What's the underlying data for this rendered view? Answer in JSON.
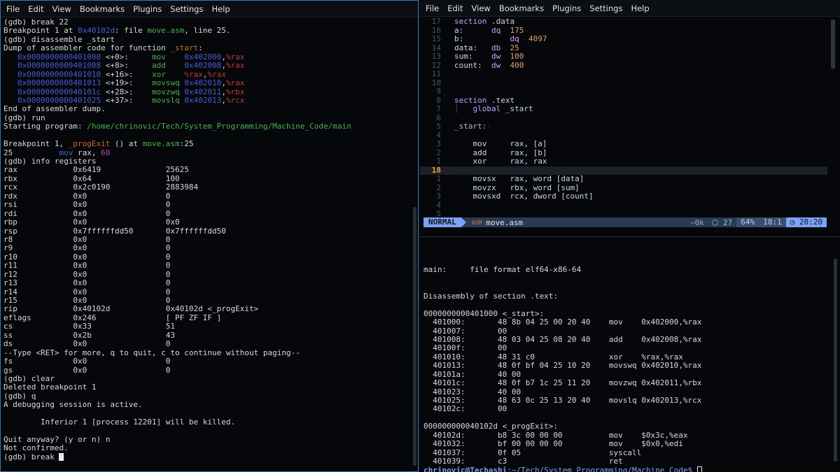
{
  "menu": [
    "File",
    "Edit",
    "View",
    "Bookmarks",
    "Plugins",
    "Settings",
    "Help"
  ],
  "left_terminal": {
    "lines": [
      [
        {
          "t": "(gdb) break 22"
        }
      ],
      [
        {
          "t": "Breakpoint 1 at "
        },
        {
          "t": "0x40102d",
          "c": "blue"
        },
        {
          "t": ": file "
        },
        {
          "t": "move.asm",
          "c": "green"
        },
        {
          "t": ", line 25."
        }
      ],
      [
        {
          "t": "(gdb) disassemble _start"
        }
      ],
      [
        {
          "t": "Dump of assembler code for function "
        },
        {
          "t": "_start",
          "c": "orange"
        },
        {
          "t": ":"
        }
      ],
      [
        {
          "t": "   "
        },
        {
          "t": "0x0000000000401000",
          "c": "blue"
        },
        {
          "t": " <+0>:     "
        },
        {
          "t": "mov",
          "c": "green"
        },
        {
          "t": "    "
        },
        {
          "t": "0x402000",
          "c": "blue"
        },
        {
          "t": ","
        },
        {
          "t": "%rax",
          "c": "red"
        }
      ],
      [
        {
          "t": "   "
        },
        {
          "t": "0x0000000000401008",
          "c": "blue"
        },
        {
          "t": " <+8>:     "
        },
        {
          "t": "add",
          "c": "green"
        },
        {
          "t": "    "
        },
        {
          "t": "0x402008",
          "c": "blue"
        },
        {
          "t": ","
        },
        {
          "t": "%rax",
          "c": "red"
        }
      ],
      [
        {
          "t": "   "
        },
        {
          "t": "0x0000000000401010",
          "c": "blue"
        },
        {
          "t": " <+16>:    "
        },
        {
          "t": "xor",
          "c": "green"
        },
        {
          "t": "    "
        },
        {
          "t": "%rax",
          "c": "red"
        },
        {
          "t": ","
        },
        {
          "t": "%rax",
          "c": "red"
        }
      ],
      [
        {
          "t": "   "
        },
        {
          "t": "0x0000000000401013",
          "c": "blue"
        },
        {
          "t": " <+19>:    "
        },
        {
          "t": "movswq",
          "c": "green"
        },
        {
          "t": " "
        },
        {
          "t": "0x402010",
          "c": "blue"
        },
        {
          "t": ","
        },
        {
          "t": "%rax",
          "c": "red"
        }
      ],
      [
        {
          "t": "   "
        },
        {
          "t": "0x000000000040101c",
          "c": "blue"
        },
        {
          "t": " <+28>:    "
        },
        {
          "t": "movzwq",
          "c": "green"
        },
        {
          "t": " "
        },
        {
          "t": "0x402011",
          "c": "blue"
        },
        {
          "t": ","
        },
        {
          "t": "%rbx",
          "c": "red"
        }
      ],
      [
        {
          "t": "   "
        },
        {
          "t": "0x0000000000401025",
          "c": "blue"
        },
        {
          "t": " <+37>:    "
        },
        {
          "t": "movslq",
          "c": "green"
        },
        {
          "t": " "
        },
        {
          "t": "0x402013",
          "c": "blue"
        },
        {
          "t": ","
        },
        {
          "t": "%rcx",
          "c": "red"
        }
      ],
      [
        {
          "t": "End of assembler dump."
        }
      ],
      [
        {
          "t": "(gdb) run"
        }
      ],
      [
        {
          "t": "Starting program: "
        },
        {
          "t": "/home/chrinovic/Tech/System_Programming/Machine_Code/main",
          "c": "green"
        }
      ],
      [
        {
          "t": ""
        }
      ],
      [
        {
          "t": "Breakpoint 1, "
        },
        {
          "t": "_progExit",
          "c": "orange"
        },
        {
          "t": " () at "
        },
        {
          "t": "move.asm",
          "c": "green"
        },
        {
          "t": ":25"
        }
      ],
      [
        {
          "t": "25          "
        },
        {
          "t": "mov",
          "c": "blue"
        },
        {
          "t": " rax, "
        },
        {
          "t": "60",
          "c": "mag"
        }
      ],
      [
        {
          "t": "(gdb) info registers"
        }
      ],
      [
        {
          "t": "rax            0x6419              25625"
        }
      ],
      [
        {
          "t": "rbx            0x64                100"
        }
      ],
      [
        {
          "t": "rcx            0x2c0190            2883984"
        }
      ],
      [
        {
          "t": "rdx            0x0                 0"
        }
      ],
      [
        {
          "t": "rsi            0x0                 0"
        }
      ],
      [
        {
          "t": "rdi            0x0                 0"
        }
      ],
      [
        {
          "t": "rbp            0x0                 0x0"
        }
      ],
      [
        {
          "t": "rsp            0x7ffffffdd50       0x7ffffffdd50"
        }
      ],
      [
        {
          "t": "r8             0x0                 0"
        }
      ],
      [
        {
          "t": "r9             0x0                 0"
        }
      ],
      [
        {
          "t": "r10            0x0                 0"
        }
      ],
      [
        {
          "t": "r11            0x0                 0"
        }
      ],
      [
        {
          "t": "r12            0x0                 0"
        }
      ],
      [
        {
          "t": "r13            0x0                 0"
        }
      ],
      [
        {
          "t": "r14            0x0                 0"
        }
      ],
      [
        {
          "t": "r15            0x0                 0"
        }
      ],
      [
        {
          "t": "rip            0x40102d            0x40102d <_progExit>"
        }
      ],
      [
        {
          "t": "eflags         0x246               [ PF ZF IF ]"
        }
      ],
      [
        {
          "t": "cs             0x33                51"
        }
      ],
      [
        {
          "t": "ss             0x2b                43"
        }
      ],
      [
        {
          "t": "ds             0x0                 0"
        }
      ],
      [
        {
          "t": "--Type <RET> for more, q to quit, c to continue without paging--"
        }
      ],
      [
        {
          "t": "fs             0x0                 0"
        }
      ],
      [
        {
          "t": "gs             0x0                 0"
        }
      ],
      [
        {
          "t": "(gdb) clear"
        }
      ],
      [
        {
          "t": "Deleted breakpoint 1"
        }
      ],
      [
        {
          "t": "(gdb) q"
        }
      ],
      [
        {
          "t": "A debugging session is active."
        }
      ],
      [
        {
          "t": ""
        }
      ],
      [
        {
          "t": "        Inferior 1 [process 12201] will be killed."
        }
      ],
      [
        {
          "t": ""
        }
      ],
      [
        {
          "t": "Quit anyway? (y or n) n"
        }
      ],
      [
        {
          "t": "Not confirmed."
        }
      ],
      [
        {
          "t": "(gdb) break "
        },
        {
          "t": "",
          "cursor": true
        }
      ]
    ]
  },
  "editor": {
    "lines": [
      {
        "n": "17",
        "code": [
          {
            "t": "section ",
            "c": "kw"
          },
          {
            "t": ".data"
          }
        ]
      },
      {
        "n": "16",
        "code": [
          {
            "t": "a:      "
          },
          {
            "t": "dq",
            "c": "kw"
          },
          {
            "t": "  "
          },
          {
            "t": "175",
            "c": "num-lit"
          }
        ]
      },
      {
        "n": "15",
        "code": [
          {
            "t": "b:          "
          },
          {
            "t": "dq",
            "c": "kw"
          },
          {
            "t": "  "
          },
          {
            "t": "4097",
            "c": "num-lit"
          }
        ]
      },
      {
        "n": "14",
        "code": [
          {
            "t": "data:   "
          },
          {
            "t": "db",
            "c": "kw"
          },
          {
            "t": "  "
          },
          {
            "t": "25",
            "c": "num-lit"
          }
        ]
      },
      {
        "n": "13",
        "code": [
          {
            "t": "sum:    "
          },
          {
            "t": "dw",
            "c": "kw"
          },
          {
            "t": "  "
          },
          {
            "t": "100",
            "c": "num-lit"
          }
        ]
      },
      {
        "n": "12",
        "code": [
          {
            "t": "count:  "
          },
          {
            "t": "dw",
            "c": "kw"
          },
          {
            "t": "  "
          },
          {
            "t": "400",
            "c": "num-lit"
          }
        ]
      },
      {
        "n": "11",
        "code": []
      },
      {
        "n": "10",
        "code": []
      },
      {
        "n": "9",
        "code": []
      },
      {
        "n": "8",
        "code": [
          {
            "t": "section ",
            "c": "kw"
          },
          {
            "t": ".text"
          }
        ]
      },
      {
        "n": "7",
        "code": [
          {
            "t": "│   ",
            "c": "guide"
          },
          {
            "t": "global ",
            "c": "kw"
          },
          {
            "t": "_start"
          }
        ]
      },
      {
        "n": "6",
        "code": []
      },
      {
        "n": "5",
        "code": [
          {
            "t": "_start:",
            "c": "lbl"
          },
          {
            "t": "⋅",
            "c": "guide"
          }
        ]
      },
      {
        "n": "4",
        "code": []
      },
      {
        "n": "3",
        "code": [
          {
            "t": "    mov     rax, [a]"
          }
        ]
      },
      {
        "n": "2",
        "code": [
          {
            "t": "    add     rax, [b]"
          }
        ]
      },
      {
        "n": "1",
        "code": [
          {
            "t": "    xor     rax, rax"
          }
        ]
      },
      {
        "n": "18",
        "current": true,
        "code": [
          {
            "t": "⋅⋅⋅⋅",
            "c": "guide"
          }
        ]
      },
      {
        "n": "1",
        "code": [
          {
            "t": "    movsx   rax, word [data]"
          }
        ]
      },
      {
        "n": "2",
        "code": [
          {
            "t": "    movzx   rbx, word [sum]"
          }
        ]
      },
      {
        "n": "3",
        "code": [
          {
            "t": "    movsxd  rcx, dword [count]"
          }
        ]
      },
      {
        "n": "4",
        "code": []
      },
      {
        "n": "5",
        "code": []
      }
    ]
  },
  "statusline": {
    "mode": "NORMAL",
    "filetype": "ASM",
    "file": "move.asm",
    "diag": "~0k",
    "pkg": "27",
    "percent": "64%",
    "position": "18:1",
    "time": "20:20"
  },
  "right_terminal": {
    "lines": [
      "",
      "main:     file format elf64-x86-64",
      "",
      "",
      "Disassembly of section .text:",
      "",
      "0000000000401000 <_start>:",
      "  401000:       48 8b 04 25 00 20 40    mov    0x402000,%rax",
      "  401007:       00",
      "  401008:       48 03 04 25 08 20 40    add    0x402008,%rax",
      "  40100f:       00",
      "  401010:       48 31 c0                xor    %rax,%rax",
      "  401013:       48 0f bf 04 25 10 20    movswq 0x402010,%rax",
      "  40101a:       40 00",
      "  40101c:       48 0f b7 1c 25 11 20    movzwq 0x402011,%rbx",
      "  401023:       40 00",
      "  401025:       48 63 0c 25 13 20 40    movslq 0x402013,%rcx",
      "  40102c:       00",
      "",
      "000000000040102d <_progExit>:",
      "  40102d:       b8 3c 00 00 00          mov    $0x3c,%eax",
      "  401032:       bf 00 00 00 00          mov    $0x0,%edi",
      "  401037:       0f 05                   syscall",
      "  401039:       c3                      ret"
    ],
    "prompt_user": "chrinovic@Techashi",
    "prompt_path": ":~/Tech/System_Programming/Machine_Code$"
  }
}
